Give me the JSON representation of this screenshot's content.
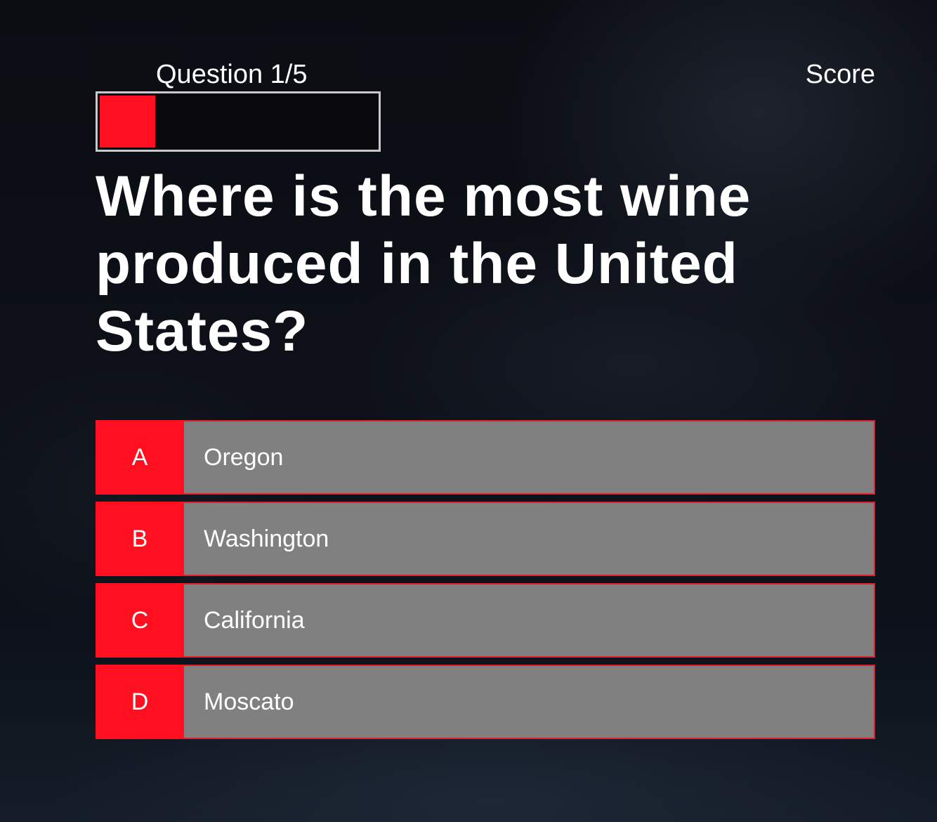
{
  "header": {
    "progress_label": "Question 1/5",
    "score_label": "Score",
    "progress": 0.2
  },
  "question": {
    "text": "Where is the most wine produced in the United States?"
  },
  "answers": [
    {
      "letter": "A",
      "text": "Oregon"
    },
    {
      "letter": "B",
      "text": "Washington"
    },
    {
      "letter": "C",
      "text": "California"
    },
    {
      "letter": "D",
      "text": "Moscato"
    }
  ],
  "colors": {
    "accent": "#ff0f1f",
    "answer_bg": "#808080",
    "track_border": "#c9c9c9"
  }
}
